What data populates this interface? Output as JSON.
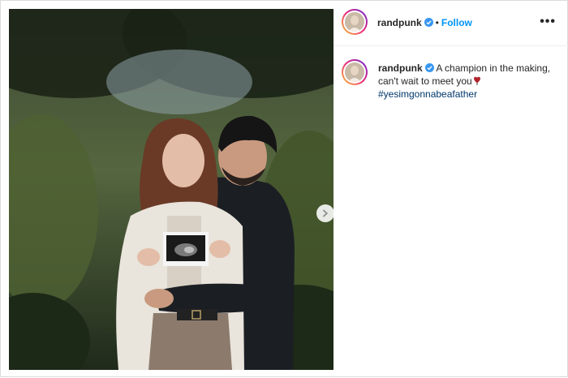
{
  "post": {
    "username": "randpunk",
    "follow_label": "Follow",
    "separator": "•",
    "more_label": "•••",
    "caption_text": "A champion in the making, can't wait to meet you",
    "hashtag": "#yesimgonnabeafather"
  },
  "icons": {
    "verified": "verified-badge-icon",
    "heart": "heart-icon",
    "next": "chevron-right-icon"
  },
  "colors": {
    "link_blue": "#0095f6",
    "hashtag_blue": "#00376b",
    "verified_blue": "#3897f0",
    "heart_red": "#b0232a"
  }
}
